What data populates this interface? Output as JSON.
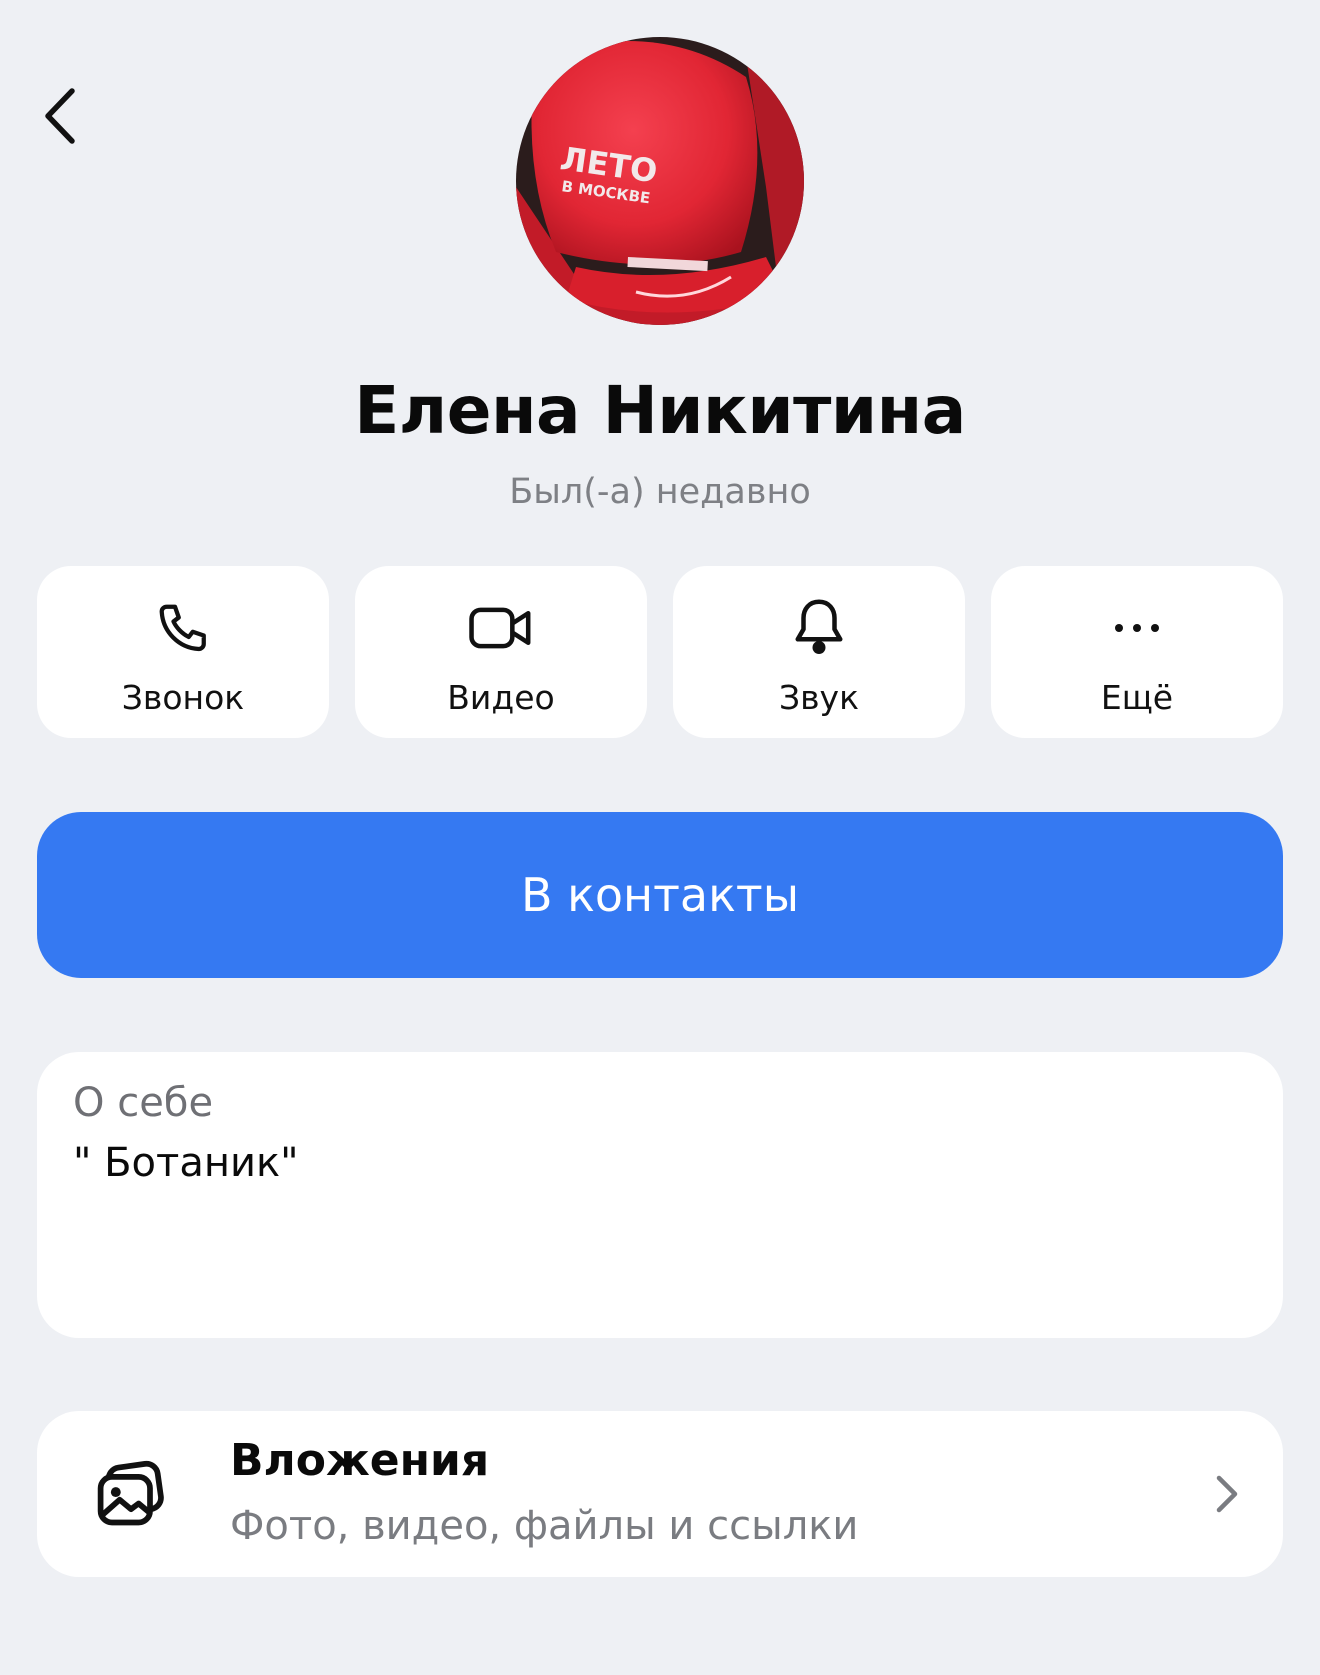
{
  "profile": {
    "name": "Елена Никитина",
    "status": "Был(-а) недавно",
    "avatar_cap_line1": "ЛЕТО",
    "avatar_cap_line2": "В МОСКВЕ"
  },
  "actions": [
    {
      "label": "Звонок",
      "icon": "phone-icon"
    },
    {
      "label": "Видео",
      "icon": "video-icon"
    },
    {
      "label": "Звук",
      "icon": "bell-icon"
    },
    {
      "label": "Ещё",
      "icon": "more-icon"
    }
  ],
  "primary_button": {
    "label": "В контакты"
  },
  "about": {
    "title": "О себе",
    "text": "\" Ботаник\""
  },
  "attachments": {
    "title": "Вложения",
    "subtitle": "Фото, видео, файлы и ссылки",
    "icon": "gallery-icon"
  },
  "colors": {
    "background": "#eef0f4",
    "accent": "#3579f2",
    "card": "#ffffff"
  }
}
